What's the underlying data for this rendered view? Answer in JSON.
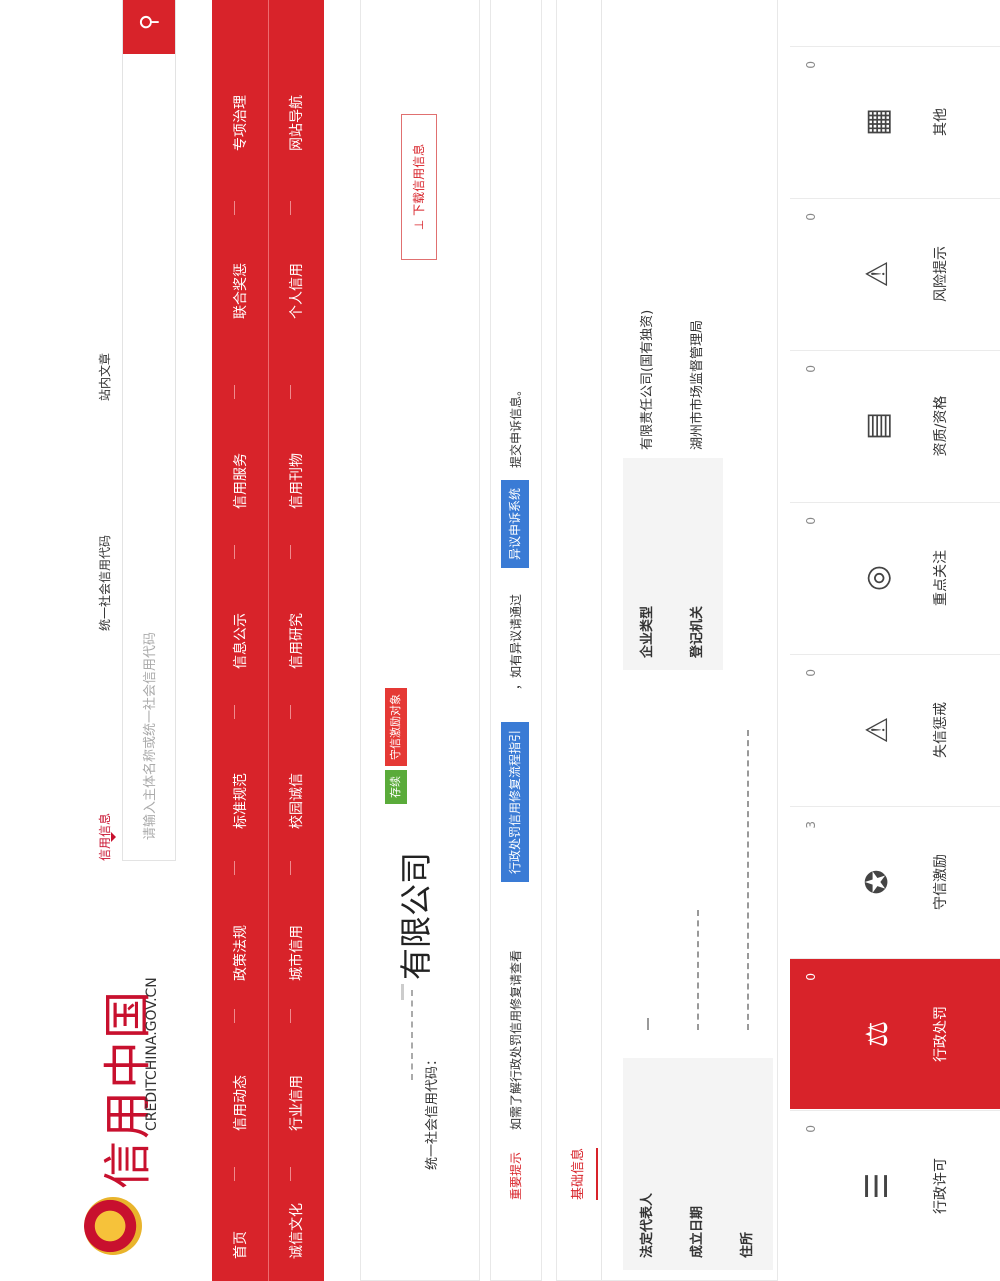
{
  "site": {
    "name_cn": "信用中国",
    "name_en": "CREDITCHINA.GOV.CN"
  },
  "search": {
    "tabs": [
      "信用信息",
      "统一社会信用代码",
      "站内文章"
    ],
    "active_tab": "信用信息",
    "placeholder": "请输入主体名称或统一社会信用代码"
  },
  "nav": {
    "row1": [
      "首页",
      "信用动态",
      "政策法规",
      "标准规范",
      "信息公示",
      "信用服务",
      "联合奖惩",
      "专项治理"
    ],
    "row2": [
      "诚信文化",
      "行业信用",
      "城市信用",
      "校园诚信",
      "信用研究",
      "信用刊物",
      "个人信用",
      "网站导航"
    ]
  },
  "company": {
    "code_label": "统一社会信用代码：",
    "name_suffix": "有限公司",
    "badge_status": "存续",
    "badge_tag": "守信激励对象",
    "download_label": "下载信用信息"
  },
  "tips": {
    "key": "重要提示",
    "text1": "如需了解行政处罚信用修复请查看",
    "btn1": "行政处罚信用修复流程指引",
    "text2": "，如有异议请通过",
    "btn2": "异议申诉系统",
    "text3": "提交申诉信息。"
  },
  "basic": {
    "title": "基础信息",
    "rows": [
      {
        "l1": "法定代表人",
        "v1": "",
        "l2": "企业类型",
        "v2": "有限责任公司(国有独资)"
      },
      {
        "l1": "成立日期",
        "v1": "",
        "l2": "登记机关",
        "v2": "湖州市市场监督管理局"
      },
      {
        "l1": "住所",
        "v1": "",
        "l2": "",
        "v2": ""
      }
    ]
  },
  "categories": [
    {
      "label": "行政许可",
      "count": "0",
      "icon": "document-icon",
      "glyph": "☰",
      "active": false
    },
    {
      "label": "行政处罚",
      "count": "0",
      "icon": "gavel-icon",
      "glyph": "⚖",
      "active": true
    },
    {
      "label": "守信激励",
      "count": "3",
      "icon": "medal-icon",
      "glyph": "✪",
      "active": false
    },
    {
      "label": "失信惩戒",
      "count": "0",
      "icon": "warning-icon",
      "glyph": "⚠",
      "active": false
    },
    {
      "label": "重点关注",
      "count": "0",
      "icon": "target-icon",
      "glyph": "◎",
      "active": false
    },
    {
      "label": "资质/资格",
      "count": "0",
      "icon": "certificate-icon",
      "glyph": "▤",
      "active": false
    },
    {
      "label": "风险提示",
      "count": "0",
      "icon": "alert-lamp-icon",
      "glyph": "⚠",
      "active": false
    },
    {
      "label": "其他",
      "count": "0",
      "icon": "other-icon",
      "glyph": "▦",
      "active": false
    }
  ]
}
